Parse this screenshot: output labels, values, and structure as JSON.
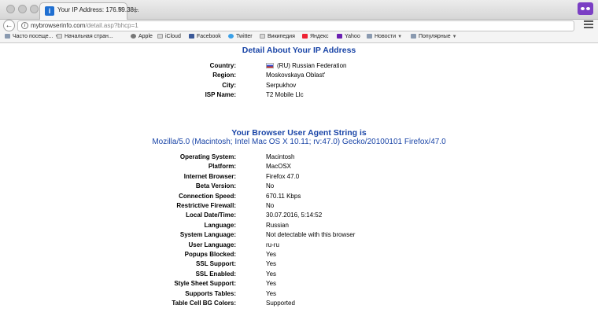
{
  "browser": {
    "tab_title": "Your IP Address: 176.59.38...",
    "tab_favicon": "i",
    "url_domain": "mybrowserinfo.com",
    "url_path": "/detail.asp?bhcp=1",
    "bookmarks": [
      {
        "label": "Часто посеще...",
        "icon": "folder-icon",
        "dropdown": true
      },
      {
        "label": "Начальная стран...",
        "icon": "page-icon",
        "dropdown": false
      },
      {
        "label": "Apple",
        "icon": "apple-icon",
        "dropdown": false
      },
      {
        "label": "iCloud",
        "icon": "page-icon",
        "dropdown": false
      },
      {
        "label": "Facebook",
        "icon": "facebook-icon",
        "dropdown": false
      },
      {
        "label": "Twitter",
        "icon": "twitter-icon",
        "dropdown": false
      },
      {
        "label": "Википедия",
        "icon": "page-icon",
        "dropdown": false
      },
      {
        "label": "Яндекс",
        "icon": "yandex-icon",
        "dropdown": false
      },
      {
        "label": "Yahoo",
        "icon": "yahoo-icon",
        "dropdown": false
      },
      {
        "label": "Новости",
        "icon": "folder-icon",
        "dropdown": true
      },
      {
        "label": "Популярные",
        "icon": "folder-icon",
        "dropdown": true
      }
    ]
  },
  "page": {
    "ip_heading": "Detail About Your IP Address",
    "ip_details": [
      {
        "label": "Country:",
        "value": "(RU) Russian Federation"
      },
      {
        "label": "Region:",
        "value": "Moskovskaya Oblast'"
      },
      {
        "label": "City:",
        "value": "Serpukhov"
      },
      {
        "label": "ISP Name:",
        "value": "T2 Mobile Llc"
      }
    ],
    "ua_heading": "Your Browser User Agent String is",
    "ua_string": "Mozilla/5.0 (Macintosh; Intel Mac OS X 10.11; rv:47.0) Gecko/20100101 Firefox/47.0",
    "browser_details": [
      {
        "label": "Operating System:",
        "value": "Macintosh"
      },
      {
        "label": "Platform:",
        "value": "MacOSX"
      },
      {
        "label": "Internet Browser:",
        "value": "Firefox 47.0"
      },
      {
        "label": "Beta Version:",
        "value": "No"
      },
      {
        "label": "Connection Speed:",
        "value": "670.11 Kbps"
      },
      {
        "label": "Restrictive Firewall:",
        "value": "No"
      },
      {
        "label": "Local Date/Time:",
        "value": "30.07.2016, 5:14:52"
      },
      {
        "label": "Language:",
        "value": "Russian"
      },
      {
        "label": "System Language:",
        "value": "Not detectable with this browser"
      },
      {
        "label": "User Language:",
        "value": "ru-ru"
      },
      {
        "label": "Popups Blocked:",
        "value": "Yes"
      },
      {
        "label": "SSL Support:",
        "value": "Yes"
      },
      {
        "label": "SSL Enabled:",
        "value": "Yes"
      },
      {
        "label": "Style Sheet Support:",
        "value": "Yes"
      },
      {
        "label": "Supports Tables:",
        "value": "Yes"
      },
      {
        "label": "Table Cell BG Colors:",
        "value": "Supported"
      }
    ]
  },
  "colors": {
    "heading": "#1a45a7",
    "private_badge": "#7b3fc4"
  }
}
